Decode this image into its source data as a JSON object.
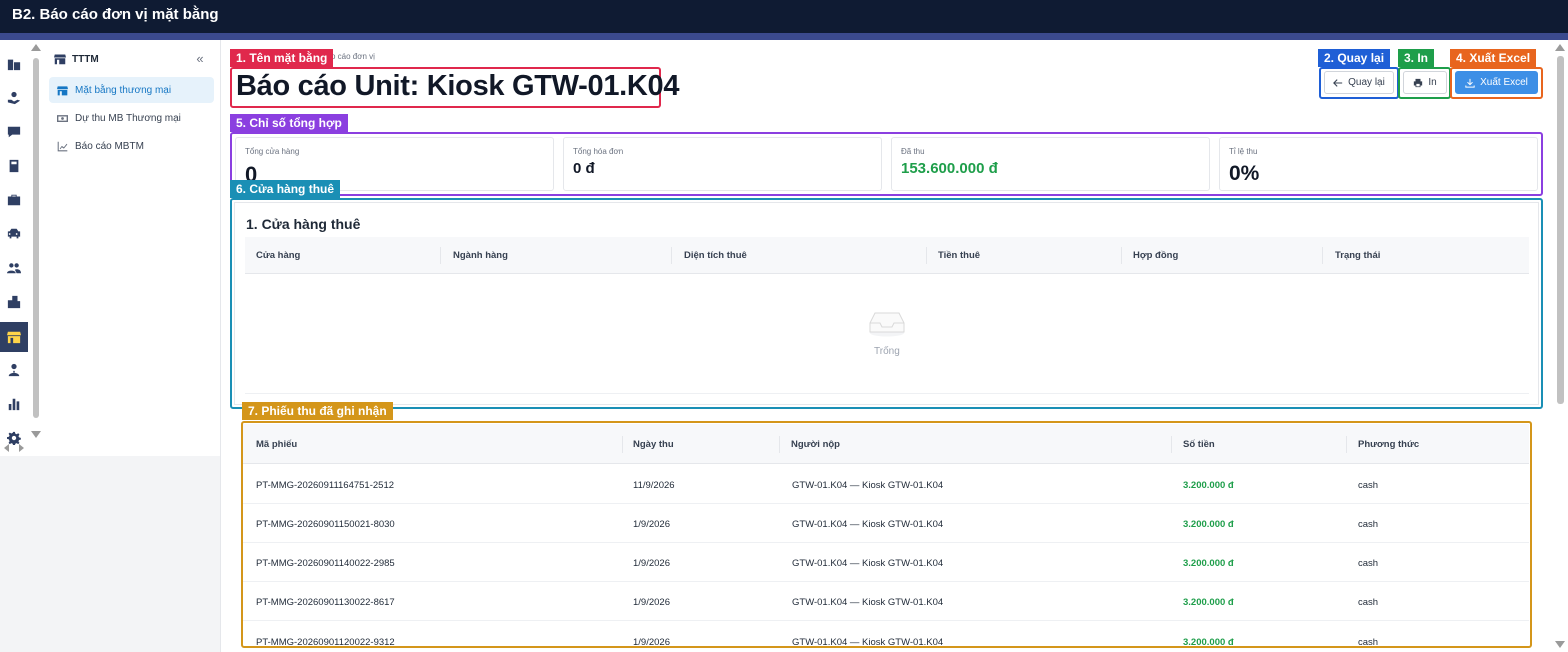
{
  "app": {
    "window_title": "B2. Báo cáo đơn vị mặt bằng"
  },
  "rail": {
    "icons": [
      "building-icon",
      "hand-coin-icon",
      "chat-icon",
      "calculator-icon",
      "briefcase-icon",
      "car-icon",
      "users-icon",
      "city-icon",
      "store-icon",
      "user-tie-icon",
      "bar-chart-icon",
      "settings-icon"
    ],
    "active_index": 8
  },
  "sidebar": {
    "header": "TTTM",
    "collapse_icon": "«",
    "items": [
      {
        "label": "Mặt bằng thương mại",
        "icon": "store-icon",
        "active": true
      },
      {
        "label": "Dự thu MB Thương mại",
        "icon": "money-icon",
        "active": false
      },
      {
        "label": "Báo cáo MBTM",
        "icon": "line-chart-icon",
        "active": false
      }
    ]
  },
  "breadcrumb": "o cáo đơn vị",
  "page_title": "Báo cáo Unit: Kiosk GTW-01.K04",
  "annotations": {
    "a1": "1. Tên mặt bằng",
    "a2": "2. Quay lại",
    "a3": "3. In",
    "a4": "4. Xuất Excel",
    "a5": "5. Chỉ số tổng hợp",
    "a6": "6. Cửa hàng thuê",
    "a7": "7. Phiếu thu đã ghi nhận"
  },
  "annotation_colors": {
    "a1": "#e0284c",
    "a2": "#1f5fd6",
    "a3": "#1e9e4a",
    "a4": "#e8651e",
    "a5": "#8b3fe0",
    "a6": "#1a8fb5",
    "a7": "#d4961a"
  },
  "buttons": {
    "back": "Quay lại",
    "print": "In",
    "export": "Xuất Excel"
  },
  "stats": [
    {
      "label": "Tổng cửa hàng",
      "value": "0"
    },
    {
      "label": "Tổng hóa đơn",
      "value": "0 đ"
    },
    {
      "label": "Đã thu",
      "value": "153.600.000 đ"
    },
    {
      "label": "Tỉ lệ thu",
      "value": "0%"
    }
  ],
  "stores_section": {
    "title": "1. Cửa hàng thuê",
    "columns": [
      "Cửa hàng",
      "Ngành hàng",
      "Diện tích thuê",
      "Tiền thuê",
      "Hợp đồng",
      "Trạng thái"
    ],
    "empty_text": "Trống"
  },
  "receipts_section": {
    "columns": [
      "Mã phiếu",
      "Ngày thu",
      "Người nộp",
      "Số tiền",
      "Phương thức"
    ],
    "rows": [
      [
        "PT-MMG-20260911164751-2512",
        "11/9/2026",
        "GTW-01.K04 — Kiosk GTW-01.K04",
        "3.200.000 đ",
        "cash"
      ],
      [
        "PT-MMG-20260901150021-8030",
        "1/9/2026",
        "GTW-01.K04 — Kiosk GTW-01.K04",
        "3.200.000 đ",
        "cash"
      ],
      [
        "PT-MMG-20260901140022-2985",
        "1/9/2026",
        "GTW-01.K04 — Kiosk GTW-01.K04",
        "3.200.000 đ",
        "cash"
      ],
      [
        "PT-MMG-20260901130022-8617",
        "1/9/2026",
        "GTW-01.K04 — Kiosk GTW-01.K04",
        "3.200.000 đ",
        "cash"
      ],
      [
        "PT-MMG-20260901120022-9312",
        "1/9/2026",
        "GTW-01.K04 — Kiosk GTW-01.K04",
        "3.200.000 đ",
        "cash"
      ]
    ]
  },
  "colors": {
    "money_green": "#1e9e4a",
    "primary_blue": "#3d8fe6",
    "topbar": "#0f1b33"
  }
}
